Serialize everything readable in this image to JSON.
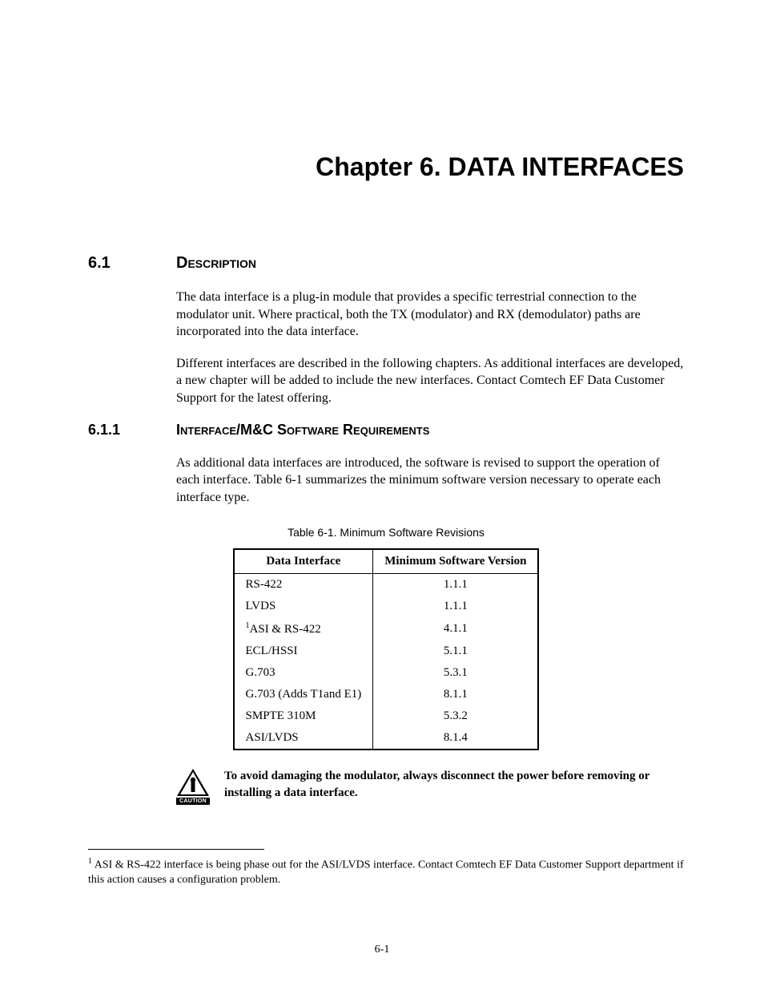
{
  "chapter_title": "Chapter 6. DATA INTERFACES",
  "section_6_1": {
    "number": "6.1",
    "title": "Description",
    "para1": "The data interface is a plug-in module that provides a specific terrestrial connection to the modulator unit. Where practical, both the TX (modulator) and RX (demodulator) paths are incorporated into the data interface.",
    "para2": "Different interfaces are described in the following chapters. As additional interfaces are developed, a new chapter will be added to include the new interfaces. Contact Comtech EF Data Customer Support for the latest offering."
  },
  "section_6_1_1": {
    "number": "6.1.1",
    "title": "Interface/M&C Software Requirements",
    "para1": "As additional data interfaces are introduced, the software is revised to support the operation of each interface. Table 6-1 summarizes the minimum software version necessary to operate each interface type."
  },
  "table": {
    "caption": "Table 6-1.  Minimum Software Revisions",
    "headers": [
      "Data Interface",
      "Minimum Software Version"
    ],
    "rows": [
      {
        "interface": "RS-422",
        "version": "1.1.1",
        "footnote": false
      },
      {
        "interface": "LVDS",
        "version": "1.1.1",
        "footnote": false
      },
      {
        "interface": "ASI & RS-422",
        "version": "4.1.1",
        "footnote": true
      },
      {
        "interface": "ECL/HSSI",
        "version": "5.1.1",
        "footnote": false
      },
      {
        "interface": "G.703",
        "version": "5.3.1",
        "footnote": false
      },
      {
        "interface": "G.703 (Adds T1and E1)",
        "version": "8.1.1",
        "footnote": false
      },
      {
        "interface": "SMPTE 310M",
        "version": "5.3.2",
        "footnote": false
      },
      {
        "interface": "ASI/LVDS",
        "version": "8.1.4",
        "footnote": false
      }
    ]
  },
  "caution": {
    "label": "CAUTION",
    "text": "To avoid damaging the modulator, always disconnect the power before removing or installing a data interface."
  },
  "footnote": {
    "marker": "1",
    "text": " ASI & RS-422 interface is being phase out for the ASI/LVDS interface. Contact Comtech EF Data Customer Support department if this action causes a configuration problem."
  },
  "page_number": "6-1"
}
